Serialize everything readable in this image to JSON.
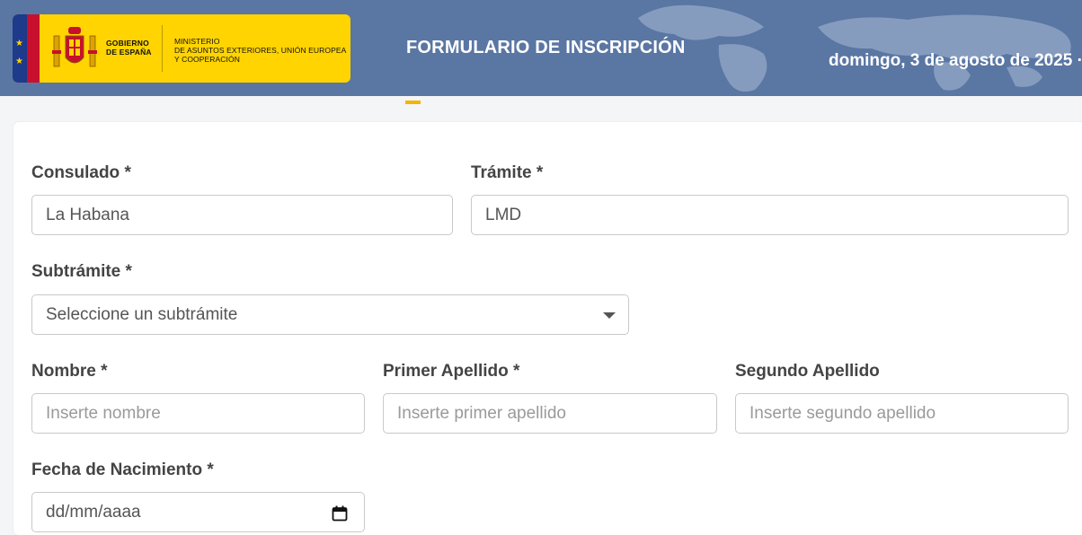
{
  "header": {
    "logo": {
      "gobierno_line1": "GOBIERNO",
      "gobierno_line2": "DE ESPAÑA",
      "ministerio_line1": "MINISTERIO",
      "ministerio_line2": "DE ASUNTOS EXTERIORES, UNIÓN EUROPEA",
      "ministerio_line3": "Y COOPERACIÓN"
    },
    "title": "FORMULARIO DE INSCRIPCIÓN",
    "date": "domingo, 3 de agosto de 2025 ·"
  },
  "form": {
    "consulado": {
      "label": "Consulado *",
      "value": "La Habana"
    },
    "tramite": {
      "label": "Trámite *",
      "value": "LMD"
    },
    "subtramite": {
      "label": "Subtrámite *",
      "value": "Seleccione un subtrámite"
    },
    "nombre": {
      "label": "Nombre *",
      "placeholder": "Inserte nombre"
    },
    "primer_apellido": {
      "label": "Primer Apellido *",
      "placeholder": "Inserte primer apellido"
    },
    "segundo_apellido": {
      "label": "Segundo Apellido",
      "placeholder": "Inserte segundo apellido"
    },
    "fecha_nacimiento": {
      "label": "Fecha de Nacimiento *",
      "placeholder": "dd/mm/aaaa"
    }
  },
  "colors": {
    "header_bg": "#5a76a3",
    "logo_bg": "#ffd400",
    "accent": "#f4b400"
  }
}
